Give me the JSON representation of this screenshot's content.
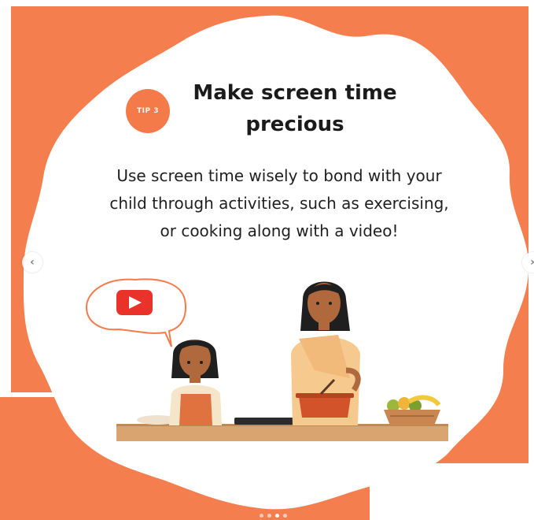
{
  "tip": {
    "badge": "TIP 3",
    "title_line1": "Make screen time",
    "title_line2": "precious"
  },
  "description": {
    "line1": "Use screen time wisely to bond with your",
    "line2": "child through activities, such as exercising,",
    "line3": "or cooking along with a video!"
  },
  "carousel": {
    "prev_icon": "chevron-left-icon",
    "next_icon": "chevron-right-icon",
    "slide_count": 4,
    "active_index": 2
  },
  "colors": {
    "accent": "#f47a4a",
    "background_orange": "#f57e4f",
    "text_dark": "#1b1b1b",
    "video_red": "#e8322a",
    "counter_wood": "#d9a46f"
  }
}
